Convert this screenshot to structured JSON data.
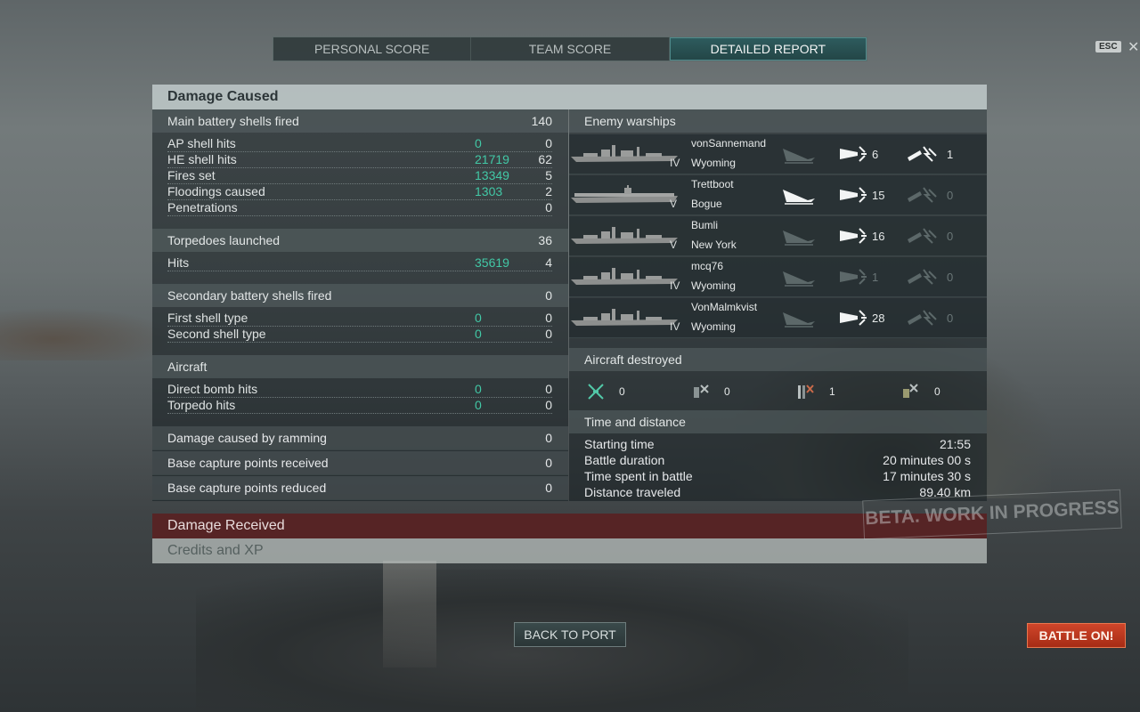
{
  "tabs": [
    "PERSONAL SCORE",
    "TEAM SCORE",
    "DETAILED REPORT"
  ],
  "esc_label": "ESC",
  "close_glyph": "✕",
  "damage_caused": {
    "title": "Damage Caused",
    "main_battery": {
      "label": "Main battery shells fired",
      "value": "140",
      "rows": [
        {
          "label": "AP shell hits",
          "v1": "0",
          "v2": "0"
        },
        {
          "label": "HE shell hits",
          "v1": "21719",
          "v2": "62"
        },
        {
          "label": "Fires set",
          "v1": "13349",
          "v2": "5"
        },
        {
          "label": "Floodings caused",
          "v1": "1303",
          "v2": "2"
        },
        {
          "label": "Penetrations",
          "v1": "",
          "v2": "0"
        }
      ]
    },
    "torpedoes": {
      "label": "Torpedoes launched",
      "value": "36",
      "rows": [
        {
          "label": "Hits",
          "v1": "35619",
          "v2": "4"
        }
      ]
    },
    "secondary": {
      "label": "Secondary battery shells fired",
      "value": "0",
      "rows": [
        {
          "label": "First shell type",
          "v1": "0",
          "v2": "0"
        },
        {
          "label": "Second shell type",
          "v1": "0",
          "v2": "0"
        }
      ]
    },
    "aircraft": {
      "label": "Aircraft",
      "rows": [
        {
          "label": "Direct bomb hits",
          "v1": "0",
          "v2": "0"
        },
        {
          "label": "Torpedo hits",
          "v1": "0",
          "v2": "0"
        }
      ]
    },
    "ramming": {
      "label": "Damage caused by ramming",
      "value": "0"
    },
    "capture_received": {
      "label": "Base capture points received",
      "value": "0"
    },
    "capture_reduced": {
      "label": "Base capture points reduced",
      "value": "0"
    }
  },
  "enemy_warships": {
    "title": "Enemy warships",
    "ships": [
      {
        "player": "vonSannemand",
        "ship": "Wyoming",
        "tier": "IV",
        "type": "battleship",
        "shells": "6",
        "torps": "1",
        "destroyed": false,
        "shells_dim": false,
        "torps_dim": false
      },
      {
        "player": "Trettboot",
        "ship": "Bogue",
        "tier": "V",
        "type": "carrier",
        "shells": "15",
        "torps": "0",
        "destroyed": true,
        "shells_dim": false,
        "torps_dim": true
      },
      {
        "player": "Bumli",
        "ship": "New York",
        "tier": "V",
        "type": "battleship",
        "shells": "16",
        "torps": "0",
        "destroyed": false,
        "shells_dim": false,
        "torps_dim": true
      },
      {
        "player": "mcq76",
        "ship": "Wyoming",
        "tier": "IV",
        "type": "battleship",
        "shells": "1",
        "torps": "0",
        "destroyed": false,
        "shells_dim": true,
        "torps_dim": true
      },
      {
        "player": "VonMalmkvist",
        "ship": "Wyoming",
        "tier": "IV",
        "type": "battleship",
        "shells": "28",
        "torps": "0",
        "destroyed": false,
        "shells_dim": false,
        "torps_dim": true
      }
    ]
  },
  "aircraft_destroyed": {
    "title": "Aircraft destroyed",
    "items": [
      {
        "icon": "fighter-icon",
        "value": "0"
      },
      {
        "icon": "bomber-icon",
        "value": "0"
      },
      {
        "icon": "torpedo-bomber-icon",
        "value": "1"
      },
      {
        "icon": "dive-bomber-icon",
        "value": "0"
      }
    ]
  },
  "time_distance": {
    "title": "Time and distance",
    "rows": [
      {
        "label": "Starting time",
        "value": "21:55"
      },
      {
        "label": "Battle duration",
        "value": "20 minutes 00 s"
      },
      {
        "label": "Time spent in battle",
        "value": "17 minutes 30 s"
      },
      {
        "label": "Distance traveled",
        "value": "89.40 km"
      }
    ]
  },
  "damage_received": {
    "title": "Damage Received"
  },
  "credits_xp": {
    "title": "Credits and XP"
  },
  "watermark": "BETA. WORK IN PROGRESS",
  "buttons": {
    "back": "BACK TO PORT",
    "battle": "BATTLE ON!"
  },
  "colors": {
    "accent_green": "#42c8a6",
    "battle_button": "#c23b20",
    "received_header": "#5a1e20"
  }
}
